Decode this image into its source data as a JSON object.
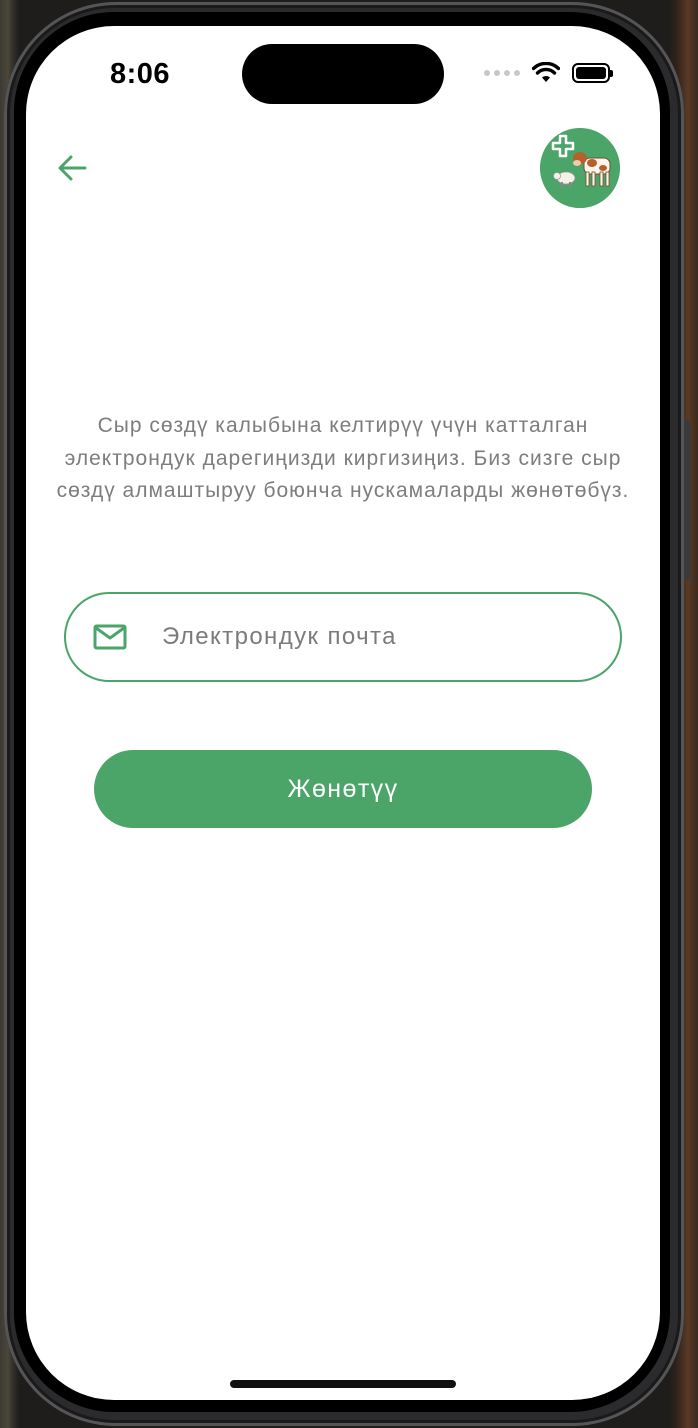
{
  "status_bar": {
    "time": "8:06"
  },
  "header": {
    "back_icon": "arrow-left-icon",
    "logo_icon": "livestock-clinic-logo"
  },
  "main": {
    "instructions": "Сыр сөздү калыбына келтирүү үчүн катталган электрондук дарегиңизди киргизиңиз. Биз сизге сыр сөздү алмаштыруу боюнча нускамаларды жөнөтөбүз.",
    "email_field": {
      "icon": "mail-icon",
      "value": "",
      "placeholder": "Электрондук почта"
    },
    "send_button_label": "Жөнөтүү"
  },
  "colors": {
    "accent": "#4ba468",
    "text_secondary": "#7d7d7d",
    "background": "#ffffff"
  }
}
